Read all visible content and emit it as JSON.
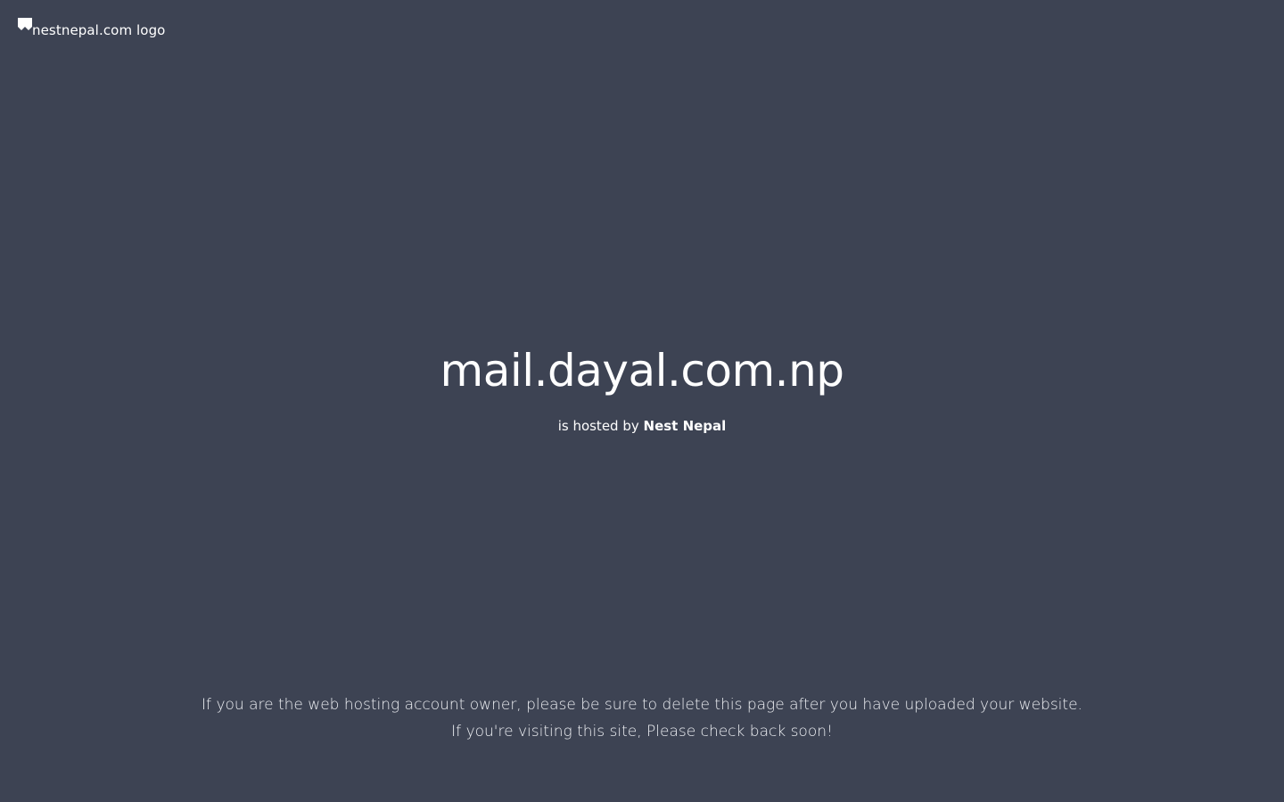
{
  "header": {
    "logo_alt": "nestnepal.com logo",
    "logo_icon": "broken-image-icon"
  },
  "main": {
    "domain": "mail.dayal.com.np",
    "hosted_prefix": "is hosted by ",
    "host_name": "Nest Nepal"
  },
  "footer": {
    "line1": "If you are the web hosting account owner, please be sure to delete this page after you have uploaded your website.",
    "line2": "If you're visiting this site, Please check back soon!"
  },
  "colors": {
    "background": "#3d4353",
    "text": "#ffffff"
  }
}
